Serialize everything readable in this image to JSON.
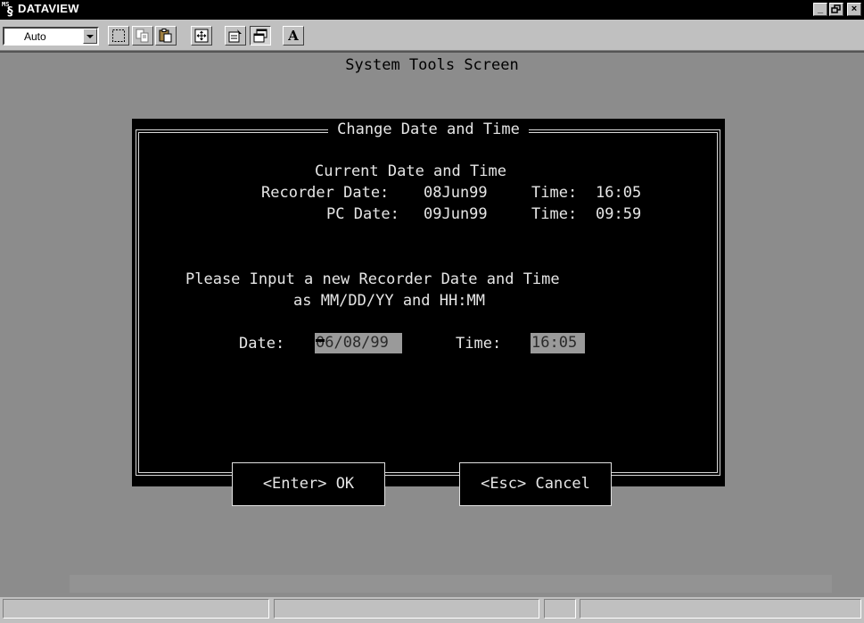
{
  "window": {
    "title": "DATAVIEW",
    "app_icon_label": "MS",
    "minimize_glyph": "_",
    "restore_glyph": "▫",
    "close_glyph": "×"
  },
  "toolbar": {
    "zoom_combo_value": "Auto",
    "font_button_label": "A",
    "icons": [
      "select-icon",
      "copy-icon",
      "paste-icon",
      "full-screen-icon",
      "properties-icon",
      "window-icon",
      "font-icon"
    ]
  },
  "screen": {
    "title": "System Tools Screen"
  },
  "dialog": {
    "title": "Change Date and Time",
    "current_heading": "Current Date and Time",
    "recorder_date_label": "Recorder Date:",
    "recorder_date_value": "08Jun99",
    "recorder_time_label": "Time:",
    "recorder_time_value": "16:05",
    "pc_date_label": "PC Date:",
    "pc_date_value": "09Jun99",
    "pc_time_label": "Time:",
    "pc_time_value": "09:59",
    "prompt_line1": "Please Input a new Recorder Date and Time",
    "prompt_line2": "as MM/DD/YY and HH:MM",
    "date_label": "Date:",
    "date_value": "06/08/99",
    "time_label": "Time:",
    "time_value": "16:05",
    "ok_label": "<Enter> OK",
    "cancel_label": "<Esc> Cancel"
  },
  "colors": {
    "dialog_bg": "#000000",
    "workarea_bg": "#8c8c8c",
    "field_bg": "#9a9a9a",
    "dialog_text": "#e6e6e6"
  }
}
